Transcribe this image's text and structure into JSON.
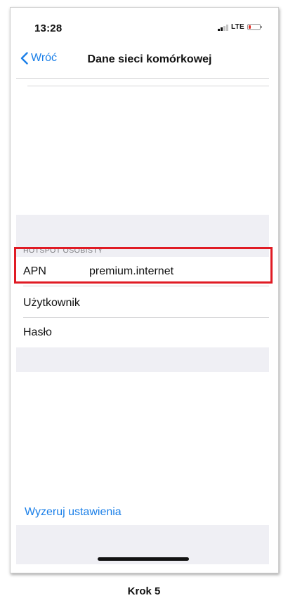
{
  "status_bar": {
    "time": "13:28",
    "network": "LTE",
    "icons": [
      "signal-icon",
      "battery-low-icon"
    ],
    "battery_color": "#e0322b"
  },
  "nav": {
    "back_label": "Wróć",
    "title": "Dane sieci komórkowej",
    "back_icon": "chevron-left-icon"
  },
  "section": {
    "header": "HOTSPOT OSOBISTY",
    "rows": [
      {
        "label": "APN",
        "value": "premium.internet"
      },
      {
        "label": "Użytkownik",
        "value": ""
      },
      {
        "label": "Hasło",
        "value": ""
      }
    ]
  },
  "reset_label": "Wyzeruj ustawienia",
  "caption": "Krok 5",
  "colors": {
    "accent": "#1a7fe8",
    "highlight": "#e01b24",
    "grouped_background": "#efeff4"
  }
}
